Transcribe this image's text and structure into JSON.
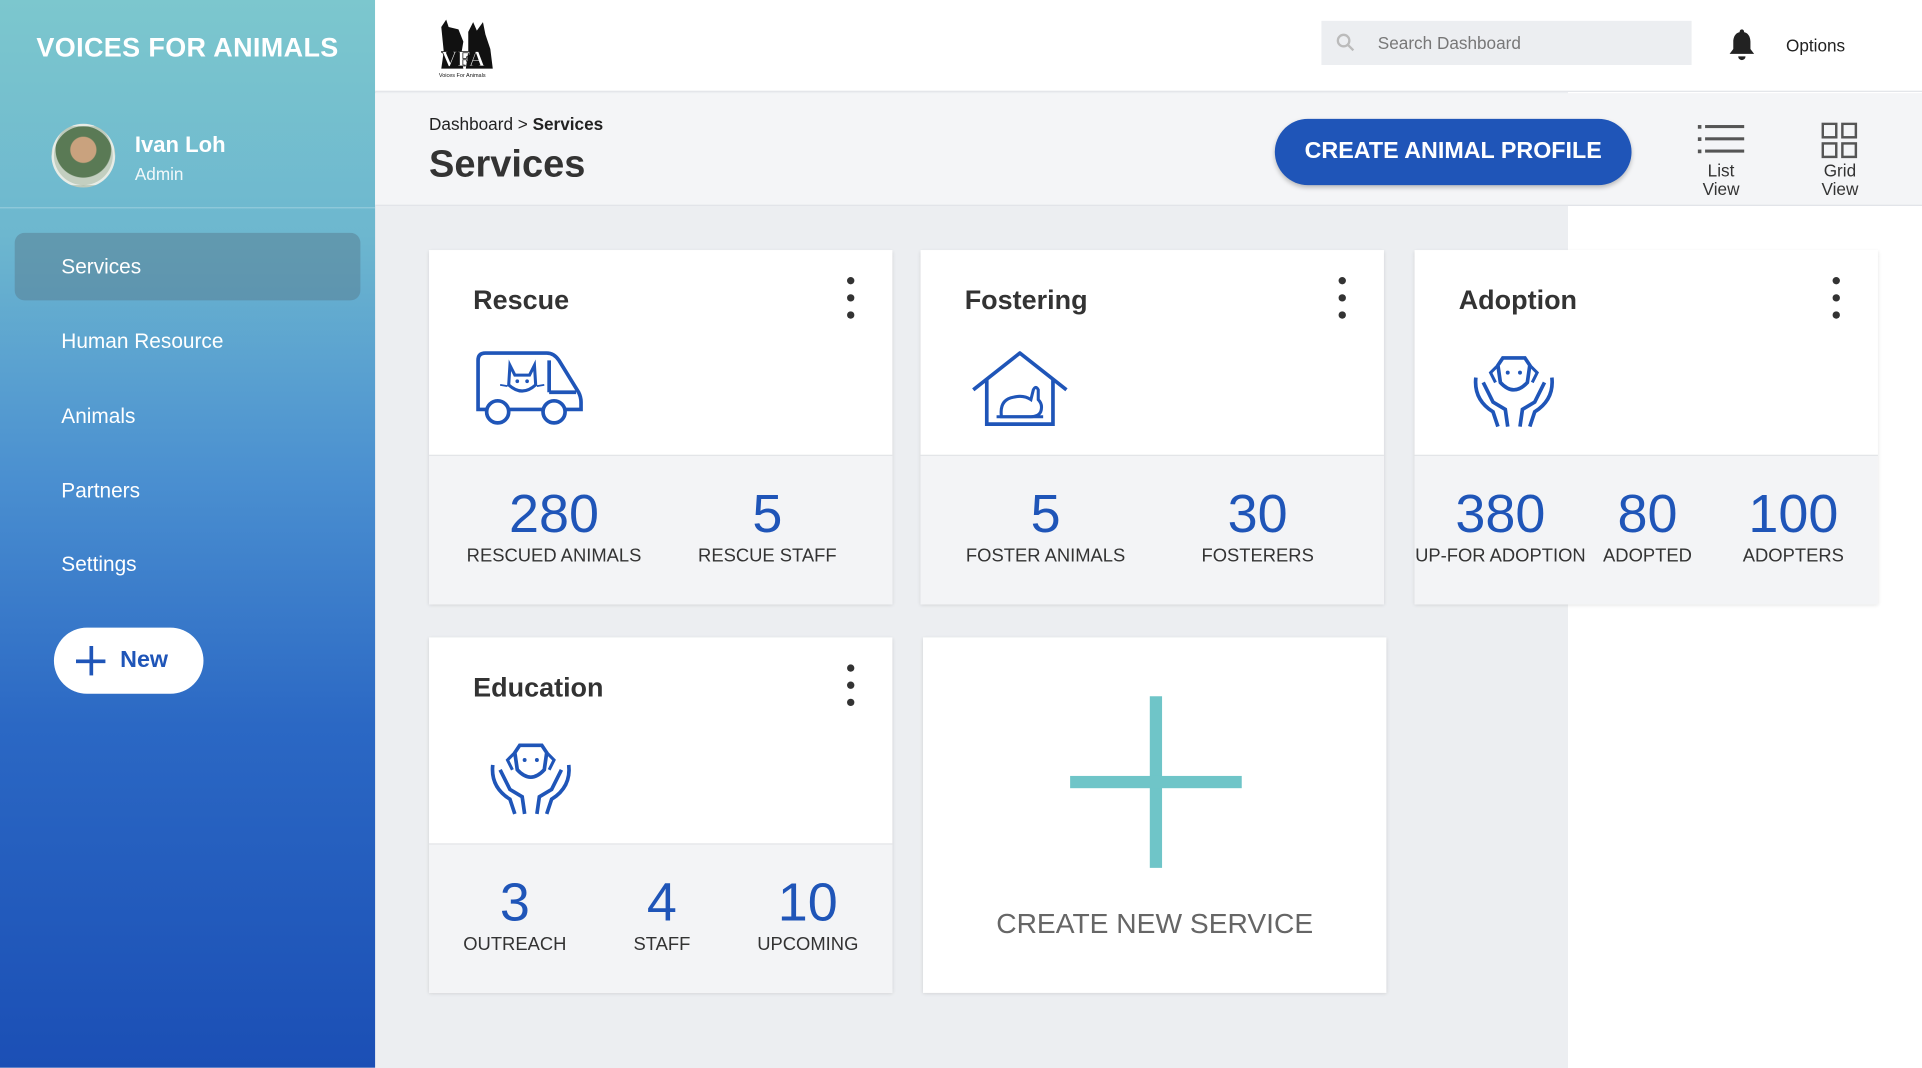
{
  "brand": "VOICES FOR ANIMALS",
  "logo": {
    "text": "VFA",
    "subtext": "Voices For Animals"
  },
  "user": {
    "name": "Ivan Loh",
    "role": "Admin"
  },
  "sidebar": {
    "items": [
      {
        "label": "Services",
        "active": true
      },
      {
        "label": "Human Resource",
        "active": false
      },
      {
        "label": "Animals",
        "active": false
      },
      {
        "label": "Partners",
        "active": false
      },
      {
        "label": "Settings",
        "active": false
      }
    ],
    "new_label": "New"
  },
  "topbar": {
    "search_placeholder": "Search Dashboard",
    "options_label": "Options"
  },
  "header": {
    "breadcrumb_root": "Dashboard",
    "breadcrumb_sep": ">",
    "breadcrumb_current": "Services",
    "title": "Services",
    "create_label": "CREATE ANIMAL PROFILE",
    "list_view": [
      "List",
      "View"
    ],
    "grid_view": [
      "Grid",
      "View"
    ]
  },
  "cards": [
    {
      "title": "Rescue",
      "icon": "rescue-van-icon",
      "stats": [
        {
          "value": "280",
          "label": "RESCUED ANIMALS"
        },
        {
          "value": "5",
          "label": "RESCUE STAFF"
        }
      ]
    },
    {
      "title": "Fostering",
      "icon": "foster-home-icon",
      "stats": [
        {
          "value": "5",
          "label": "FOSTER ANIMALS"
        },
        {
          "value": "30",
          "label": "FOSTERERS"
        }
      ]
    },
    {
      "title": "Adoption",
      "icon": "adoption-hands-icon",
      "stats": [
        {
          "value": "380",
          "label": "UP-FOR ADOPTION"
        },
        {
          "value": "80",
          "label": "ADOPTED"
        },
        {
          "value": "100",
          "label": "ADOPTERS"
        }
      ]
    },
    {
      "title": "Education",
      "icon": "education-hands-icon",
      "stats": [
        {
          "value": "3",
          "label": "OUTREACH"
        },
        {
          "value": "4",
          "label": "STAFF"
        },
        {
          "value": "10",
          "label": "UPCOMING"
        }
      ]
    }
  ],
  "create_service_label": "CREATE NEW SERVICE",
  "colors": {
    "accent": "#1f55b8",
    "teal": "#6fc5c8",
    "sidebar_top": "#7cc7ce",
    "sidebar_bottom": "#1b4fb5"
  }
}
